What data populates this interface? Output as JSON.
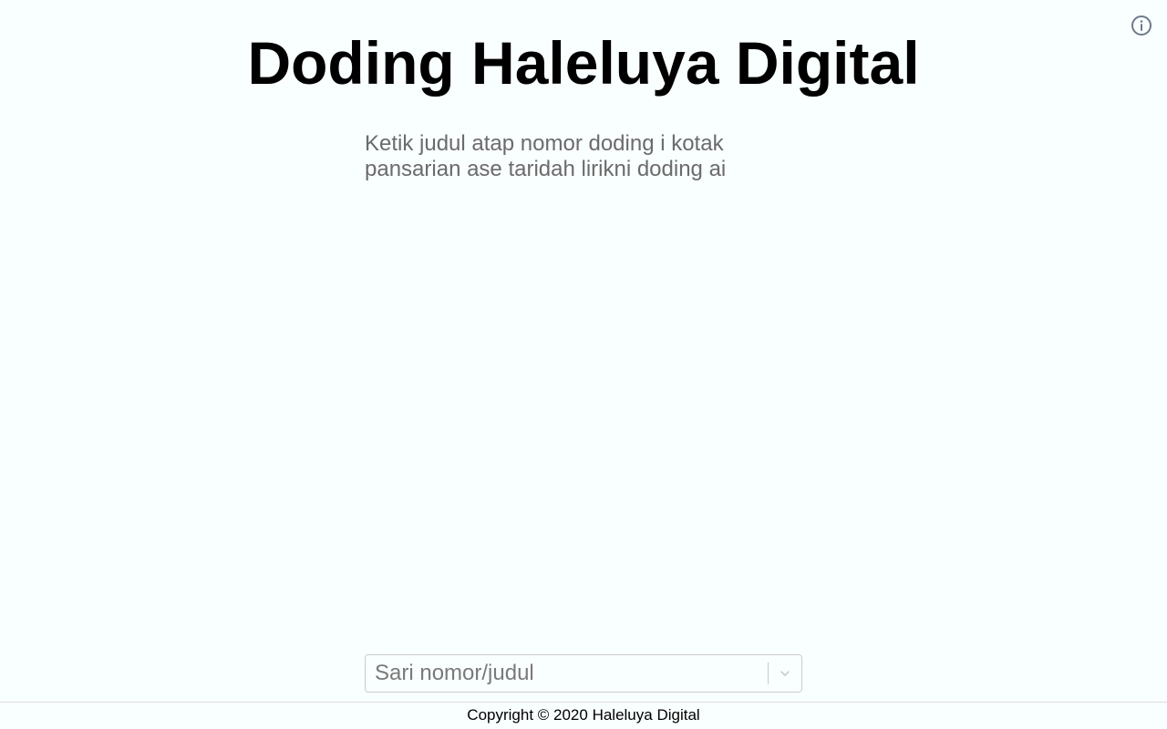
{
  "header": {
    "title": "Doding Haleluya Digital",
    "info_icon": "info-circle-icon"
  },
  "main": {
    "instructions": "Ketik judul atap nomor doding i kotak pansarian ase taridah lirikni doding ai"
  },
  "search": {
    "placeholder": "Sari nomor/judul",
    "value": "",
    "dropdown_icon": "chevron-down-icon"
  },
  "footer": {
    "copyright": "Copyright © 2020 Haleluya Digital"
  },
  "colors": {
    "background": "#f9feff",
    "title": "#000000",
    "instructions": "#6b6b6b",
    "icon": "#6e7a8a",
    "border": "#cccccc"
  }
}
